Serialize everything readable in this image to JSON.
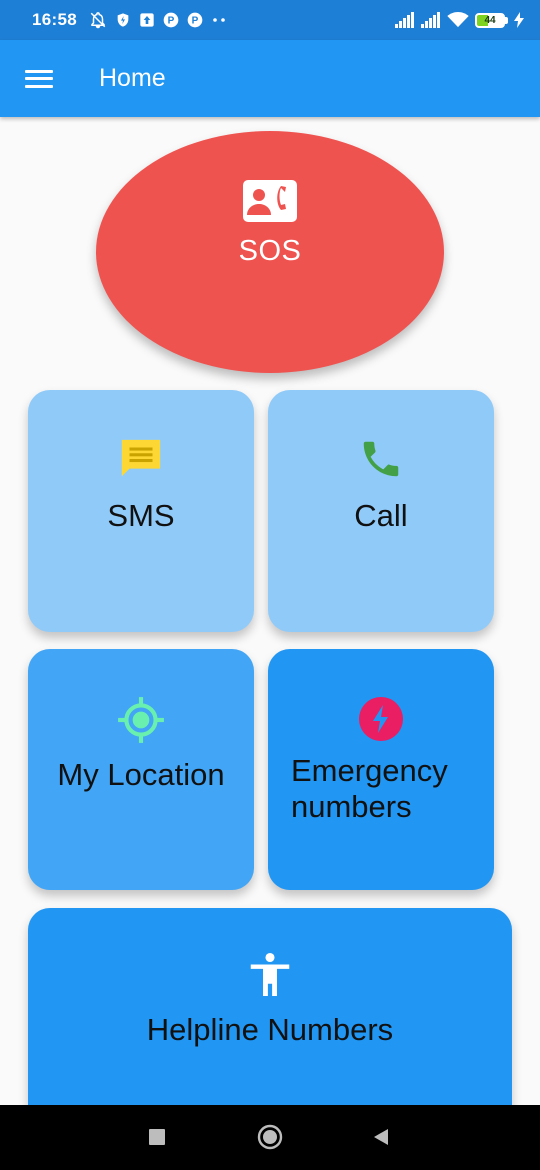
{
  "status_bar": {
    "time": "16:58",
    "battery": "44",
    "battery_level": 0.44,
    "icons": [
      "muted-bell-icon",
      "shield-icon",
      "upload-icon",
      "p-icon",
      "p-icon",
      "more-dots-icon",
      "signal-icon",
      "signal-icon",
      "wifi-icon",
      "battery-icon",
      "charging-icon"
    ]
  },
  "app_bar": {
    "title": "Home",
    "menu_icon": "menu-icon"
  },
  "sos": {
    "label": "SOS",
    "icon": "contact-phone-icon",
    "color": "#ef5350"
  },
  "cards": {
    "sms": {
      "label": "SMS",
      "icon": "chat-icon",
      "icon_color": "#fdd835",
      "bg": "#90caf9"
    },
    "call": {
      "label": "Call",
      "icon": "phone-icon",
      "icon_color": "#43a047",
      "bg": "#90caf9"
    },
    "location": {
      "label": "My Location",
      "icon": "gps-icon",
      "icon_color": "#69f0ae",
      "bg": "#42a5f5"
    },
    "emergency": {
      "label": "Emergency numbers",
      "icon": "flash-icon",
      "icon_color": "#e91e63",
      "bg": "#2196f3"
    },
    "helpline": {
      "label": "Helpline Numbers",
      "icon": "accessibility-icon",
      "icon_color": "#ffffff",
      "bg": "#2196f3"
    }
  },
  "nav_bar": {
    "buttons": [
      "recents-square-icon",
      "home-circle-icon",
      "back-triangle-icon"
    ]
  }
}
